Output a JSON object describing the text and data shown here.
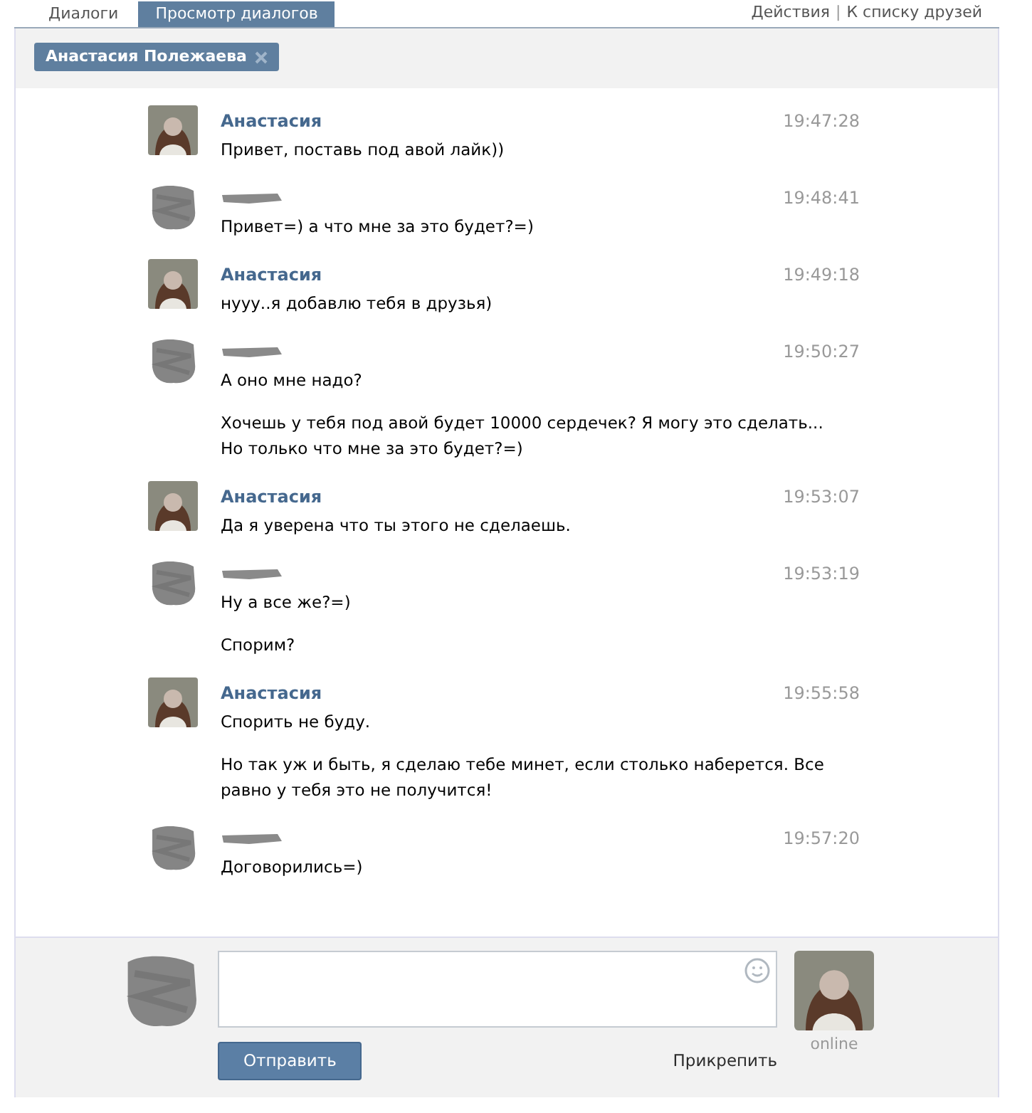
{
  "tabs": [
    {
      "label": "Диалоги",
      "selected": false
    },
    {
      "label": "Просмотр диалогов",
      "selected": true
    }
  ],
  "header_links": [
    "Действия",
    "|",
    "К списку друзей"
  ],
  "recipient_chip": {
    "label": "Анастасия Полежаева"
  },
  "messages": [
    {
      "kind": "anastasia",
      "name": "Анастасия",
      "time": "19:47:28",
      "paragraphs": [
        "Привет, поставь под авой лайк))"
      ]
    },
    {
      "kind": "redacted",
      "time": "19:48:41",
      "paragraphs": [
        "Привет=) а что мне за это будет?=)"
      ]
    },
    {
      "kind": "anastasia",
      "name": "Анастасия",
      "time": "19:49:18",
      "paragraphs": [
        "нууу..я добавлю тебя в друзья)"
      ]
    },
    {
      "kind": "redacted",
      "time": "19:50:27",
      "paragraphs": [
        "А оно мне надо?",
        "Хочешь у тебя под авой будет 10000 сердечек? Я могу это сделать... Но только что мне за это будет?=)"
      ]
    },
    {
      "kind": "anastasia",
      "name": "Анастасия",
      "time": "19:53:07",
      "paragraphs": [
        "Да я уверена что ты этого не сделаешь."
      ]
    },
    {
      "kind": "redacted",
      "time": "19:53:19",
      "paragraphs": [
        "Ну а все же?=)",
        "Спорим?"
      ]
    },
    {
      "kind": "anastasia",
      "name": "Анастасия",
      "time": "19:55:58",
      "paragraphs": [
        "Спорить не буду.",
        "Но так уж и быть, я сделаю тебе минет, если столько наберется. Все равно у тебя это не получится!"
      ]
    },
    {
      "kind": "redacted",
      "time": "19:57:20",
      "paragraphs": [
        "Договорились=)"
      ]
    }
  ],
  "composer": {
    "send_button": "Отправить",
    "attach_link": "Прикрепить",
    "status": "online"
  }
}
